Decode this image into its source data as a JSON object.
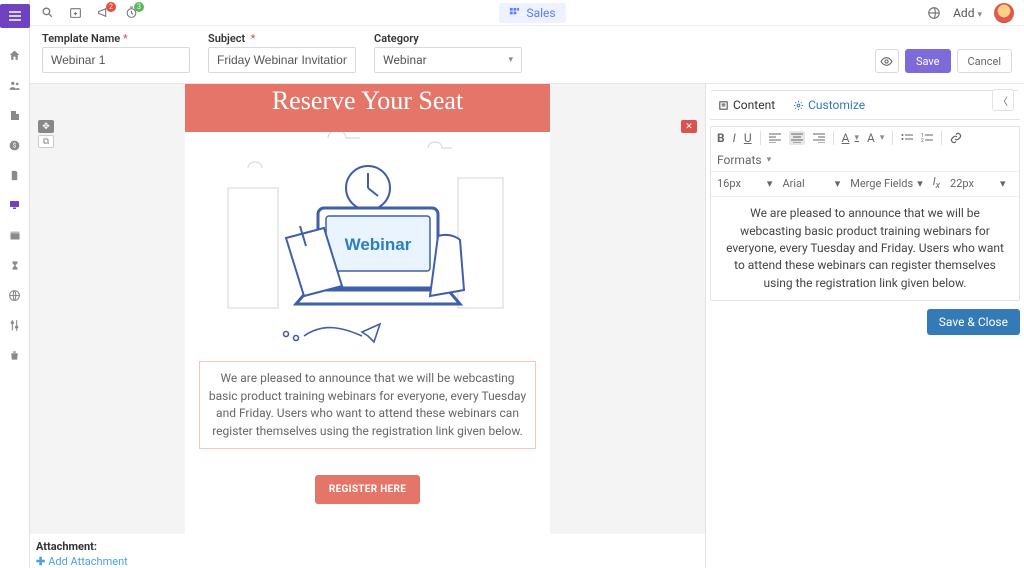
{
  "topbar": {
    "badge_announce": "2",
    "badge_timer": "3",
    "sales_label": "Sales",
    "add_label": "Add"
  },
  "fields": {
    "template_name_label": "Template Name",
    "template_name_value": "Webinar 1",
    "subject_label": "Subject",
    "subject_value": "Friday Webinar Invitation",
    "category_label": "Category",
    "category_value": "Webinar",
    "save_label": "Save",
    "cancel_label": "Cancel"
  },
  "template": {
    "hero_text": "Reserve Your Seat",
    "illustration_label": "Webinar",
    "body_text": "We are pleased to announce that we will be webcasting basic product training webinars for everyone, every Tuesday and Friday. Users who want to attend these webinars can register themselves using the registration link given below.",
    "cta_label": "REGISTER HERE"
  },
  "attachment": {
    "label": "Attachment:",
    "add_label": "Add Attachment"
  },
  "panel": {
    "tab_content": "Content",
    "tab_customize": "Customize",
    "rte": {
      "formats_label": "Formats",
      "font_size": "16px",
      "font_family": "Arial",
      "merge_fields_label": "Merge Fields",
      "size2": "22px",
      "body": "We are pleased to announce that we will be webcasting basic product training webinars for everyone, every Tuesday and Friday. Users who want to attend these webinars can register themselves using the registration link given below."
    },
    "save_close_label": "Save & Close"
  }
}
